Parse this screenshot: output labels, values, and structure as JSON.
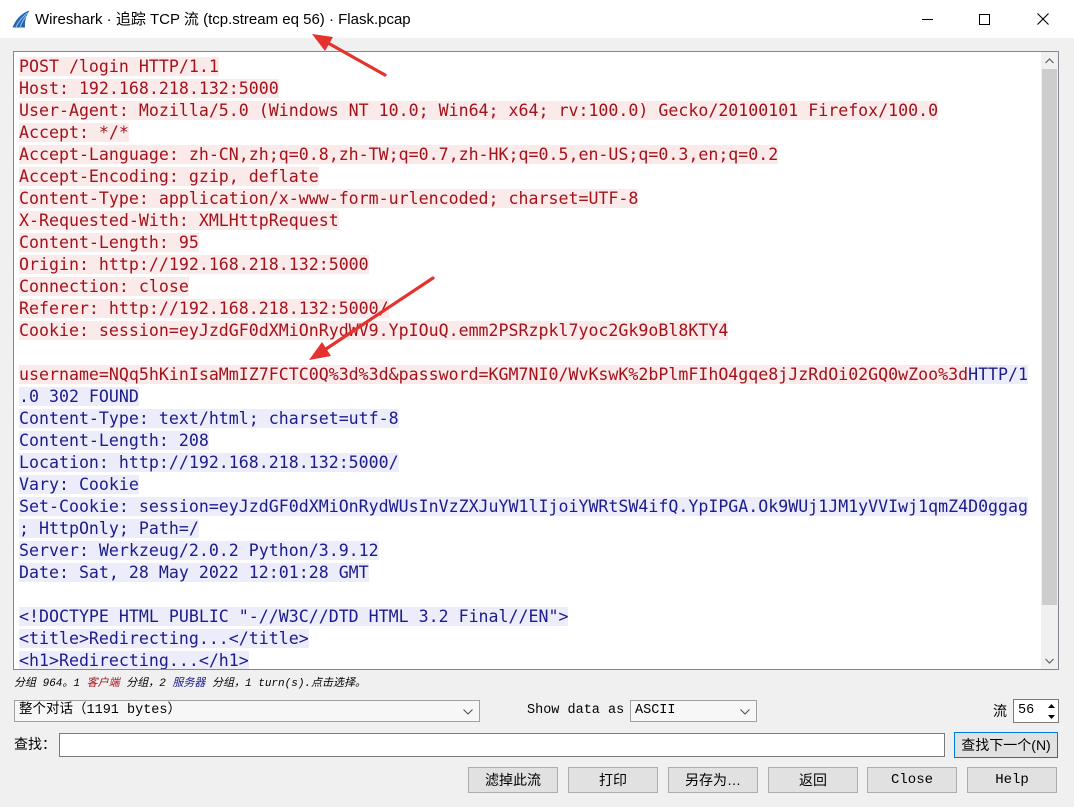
{
  "window": {
    "title": "Wireshark · 追踪 TCP 流 (tcp.stream eq 56) · Flask.pcap",
    "icons": {
      "app": "wireshark-fin-icon",
      "minimize": "minimize-icon",
      "maximize": "maximize-icon",
      "close": "close-icon"
    }
  },
  "colors": {
    "client_text": "#a3121b",
    "client_background": "#fbeaea",
    "server_text": "#1c1c8a",
    "server_background": "#ececfb",
    "annotation_arrow": "#e5322d",
    "default_button_border": "#0078d7"
  },
  "stream": {
    "scrollbar": {
      "position_fraction": 0,
      "visible_fraction": 0.92
    },
    "lines": [
      {
        "segments": [
          {
            "client": true,
            "text": "POST /login HTTP/1.1"
          }
        ]
      },
      {
        "segments": [
          {
            "client": true,
            "text": "Host: 192.168.218.132:5000"
          }
        ]
      },
      {
        "segments": [
          {
            "client": true,
            "text": "User-Agent: Mozilla/5.0 (Windows NT 10.0; Win64; x64; rv:100.0) Gecko/20100101 Firefox/100.0"
          }
        ]
      },
      {
        "segments": [
          {
            "client": true,
            "text": "Accept: */*"
          }
        ]
      },
      {
        "segments": [
          {
            "client": true,
            "text": "Accept-Language: zh-CN,zh;q=0.8,zh-TW;q=0.7,zh-HK;q=0.5,en-US;q=0.3,en;q=0.2"
          }
        ]
      },
      {
        "segments": [
          {
            "client": true,
            "text": "Accept-Encoding: gzip, deflate"
          }
        ]
      },
      {
        "segments": [
          {
            "client": true,
            "text": "Content-Type: application/x-www-form-urlencoded; charset=UTF-8"
          }
        ]
      },
      {
        "segments": [
          {
            "client": true,
            "text": "X-Requested-With: XMLHttpRequest"
          }
        ]
      },
      {
        "segments": [
          {
            "client": true,
            "text": "Content-Length: 95"
          }
        ]
      },
      {
        "segments": [
          {
            "client": true,
            "text": "Origin: http://192.168.218.132:5000"
          }
        ]
      },
      {
        "segments": [
          {
            "client": true,
            "text": "Connection: close"
          }
        ]
      },
      {
        "segments": [
          {
            "client": true,
            "text": "Referer: http://192.168.218.132:5000/"
          }
        ]
      },
      {
        "segments": [
          {
            "client": true,
            "text": "Cookie: session=eyJzdGF0dXMiOnRydWV9.YpIOuQ.emm2PSRzpkl7yoc2Gk9oBl8KTY4"
          }
        ]
      },
      {
        "segments": []
      },
      {
        "segments": [
          {
            "client": true,
            "text": "username=NQq5hKinIsaMmIZ7FCTC0Q%3d%3d&password=KGM7NI0/WvKswK%2bPlmFIhO4gqe8jJzRdOi02GQ0wZoo%3d"
          },
          {
            "client": false,
            "text": "HTTP/1"
          }
        ]
      },
      {
        "segments": [
          {
            "client": false,
            "text": ".0 302 FOUND"
          }
        ]
      },
      {
        "segments": [
          {
            "client": false,
            "text": "Content-Type: text/html; charset=utf-8"
          }
        ]
      },
      {
        "segments": [
          {
            "client": false,
            "text": "Content-Length: 208"
          }
        ]
      },
      {
        "segments": [
          {
            "client": false,
            "text": "Location: http://192.168.218.132:5000/"
          }
        ]
      },
      {
        "segments": [
          {
            "client": false,
            "text": "Vary: Cookie"
          }
        ]
      },
      {
        "segments": [
          {
            "client": false,
            "text": "Set-Cookie: session=eyJzdGF0dXMiOnRydWUsInVzZXJuYW1lIjoiYWRtSW4ifQ.YpIPGA.Ok9WUj1JM1yVVIwj1qmZ4D0ggag"
          }
        ]
      },
      {
        "segments": [
          {
            "client": false,
            "text": "; HttpOnly; Path=/"
          }
        ]
      },
      {
        "segments": [
          {
            "client": false,
            "text": "Server: Werkzeug/2.0.2 Python/3.9.12"
          }
        ]
      },
      {
        "segments": [
          {
            "client": false,
            "text": "Date: Sat, 28 May 2022 12:01:28 GMT"
          }
        ]
      },
      {
        "segments": []
      },
      {
        "segments": [
          {
            "client": false,
            "text": "<!DOCTYPE HTML PUBLIC \"-//W3C//DTD HTML 3.2 Final//EN\">"
          }
        ]
      },
      {
        "segments": [
          {
            "client": false,
            "text": "<title>Redirecting...</title>"
          }
        ]
      },
      {
        "segments": [
          {
            "client": false,
            "text": "<h1>Redirecting...</h1>"
          }
        ]
      }
    ]
  },
  "status": {
    "text_1": "分组 964。1 ",
    "client_label": "客户端",
    "text_2": " 分组，2 ",
    "server_label": "服务器",
    "text_3": " 分组，1 turn(s).点击选择。"
  },
  "controls": {
    "conversation": "整个对话（1191 bytes）",
    "show_data_as_label": "Show data as",
    "show_data_as": "ASCII",
    "stream_label": "流",
    "stream_number": "56",
    "icons": {
      "dropdown": "chevron-down-icon",
      "spin_up": "spin-up-icon",
      "spin_down": "spin-down-icon"
    }
  },
  "find": {
    "label": "查找：",
    "value": "",
    "next_button": "查找下一个(N)"
  },
  "buttons": {
    "filter_out": "滤掉此流",
    "print": "打印",
    "save_as": "另存为…",
    "back": "返回",
    "close": "Close",
    "help": "Help"
  }
}
